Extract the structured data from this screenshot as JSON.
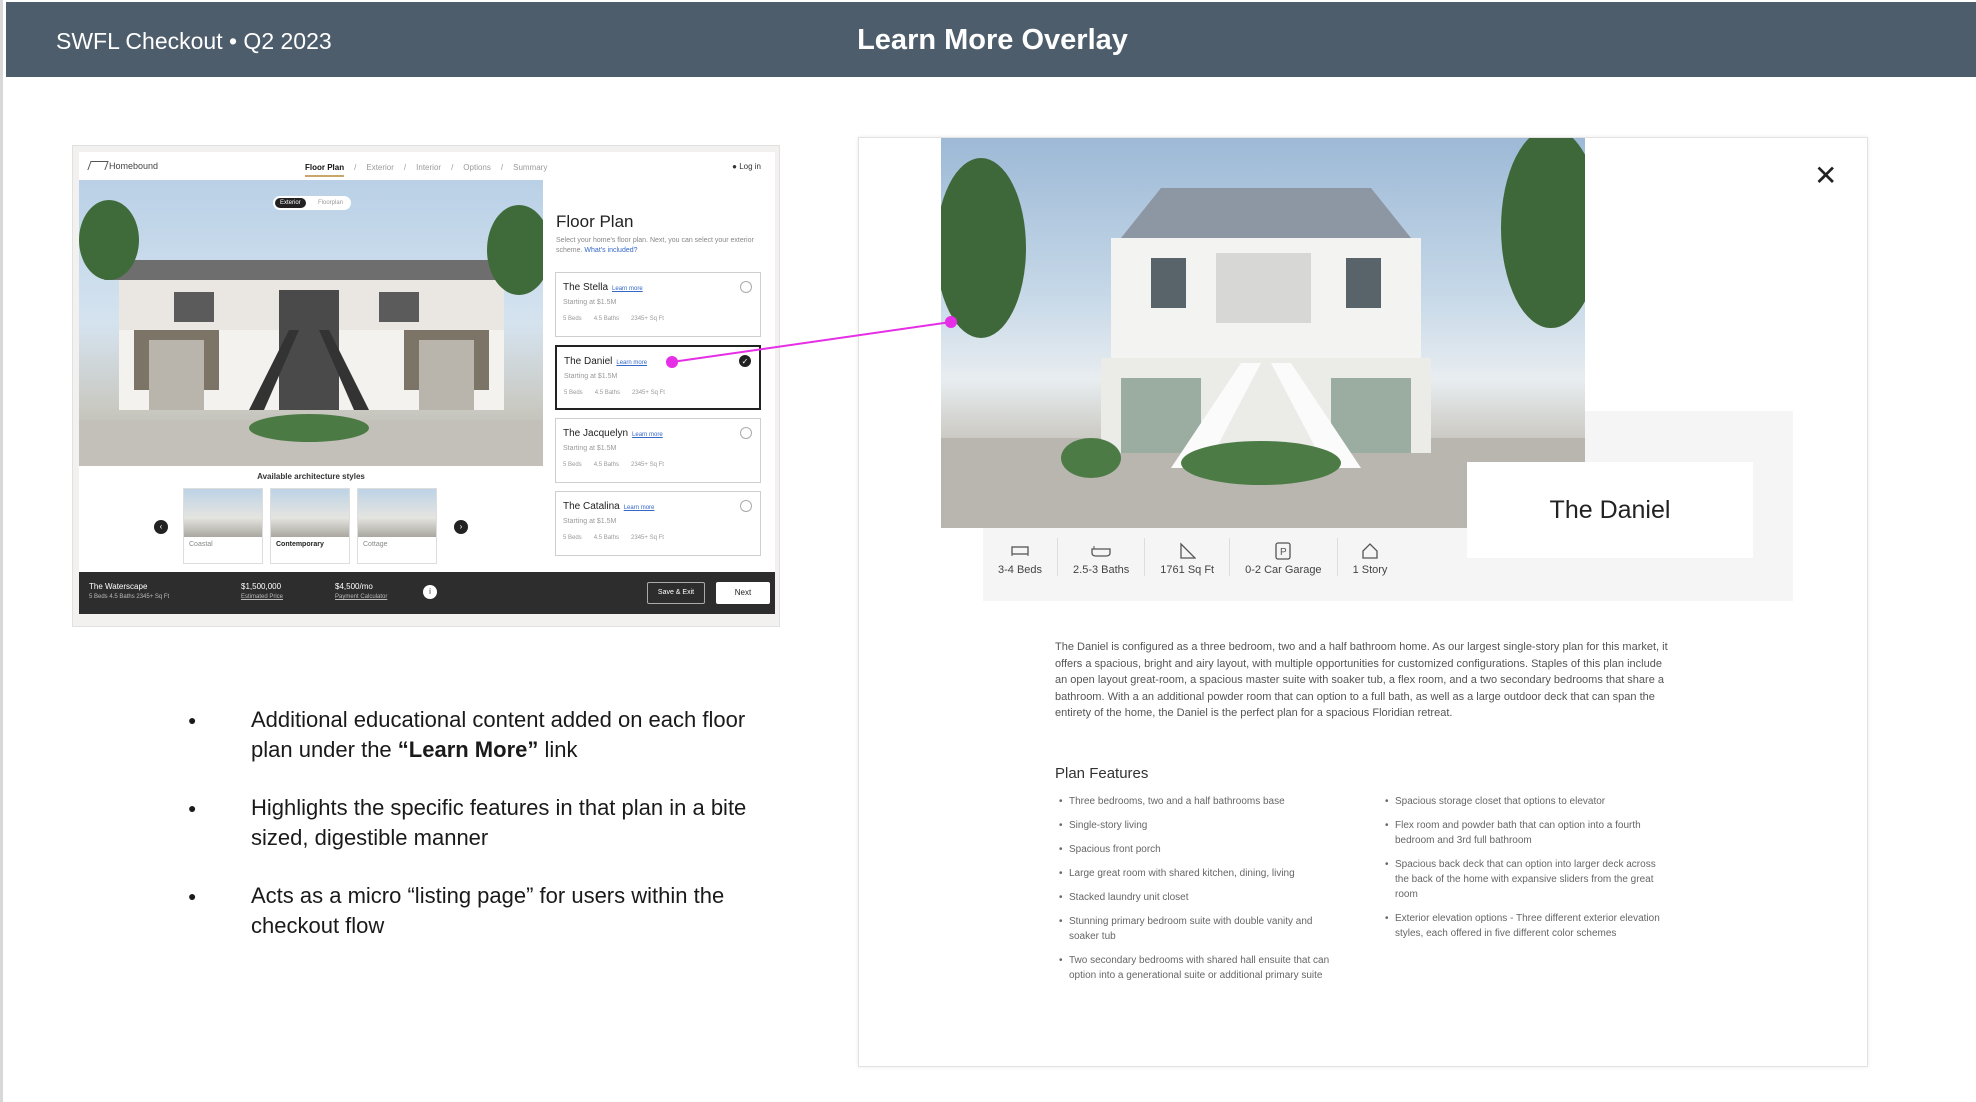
{
  "header": {
    "left": "SWFL Checkout  • Q2 2023",
    "title": "Learn More Overlay"
  },
  "mockup": {
    "brand": "Homebound",
    "steps": [
      "Floor Plan",
      "/",
      "Exterior",
      "/",
      "Interior",
      "/",
      "Options",
      "/",
      "Summary"
    ],
    "login": "Log in",
    "toggle_on": "Exterior",
    "toggle_off": "Floorplan",
    "styles_heading": "Available architecture styles",
    "styles": [
      "Coastal",
      "Contemporary",
      "Cottage"
    ],
    "panel_title": "Floor Plan",
    "panel_sub": "Select your home's floor plan. Next, you can select your exterior scheme.",
    "panel_link": "What's included?",
    "learn_more": "Learn more",
    "plans": [
      {
        "name": "The Stella",
        "price": "Starting at $1.5M"
      },
      {
        "name": "The Daniel",
        "price": "Starting at $1.5M"
      },
      {
        "name": "The Jacquelyn",
        "price": "Starting at $1.5M"
      },
      {
        "name": "The Catalina",
        "price": "Starting at $1.5M"
      }
    ],
    "plan_specs": [
      "5 Beds",
      "4.5 Baths",
      "2345+ Sq Ft"
    ],
    "footer": {
      "home": "The Waterscape",
      "home_specs": "5 Beds    4.5 Baths    2345+ Sq Ft",
      "price": "$1,500,000",
      "price_label": "Estimated Price",
      "monthly": "$4,500/mo",
      "monthly_label": "Payment Calculator",
      "save": "Save & Exit",
      "next": "Next"
    }
  },
  "bullets": [
    {
      "pre": "Additional educational content added on each floor plan under the ",
      "bold": "“Learn More”",
      "post": " link"
    },
    {
      "pre": "Highlights the specific features in that plan in a bite sized, digestible manner",
      "bold": "",
      "post": ""
    },
    {
      "pre": "Acts as a micro “listing page” for users within the checkout flow",
      "bold": "",
      "post": ""
    }
  ],
  "overlay": {
    "close_icon": "✕",
    "name": "The Daniel",
    "stats": [
      {
        "icon": "bed-icon",
        "label": "3-4 Beds"
      },
      {
        "icon": "bath-icon",
        "label": "2.5-3 Baths"
      },
      {
        "icon": "area-icon",
        "label": "1761 Sq Ft"
      },
      {
        "icon": "parking-icon",
        "label": "0-2 Car Garage"
      },
      {
        "icon": "home-icon",
        "label": "1 Story"
      }
    ],
    "description": "The Daniel is configured as a three bedroom, two and a half bathroom home. As our largest single-story plan for this market, it offers a spacious, bright and airy layout, with multiple opportunities for customized configurations. Staples of this plan include an open layout great-room, a spacious master suite with soaker tub, a flex room, and a two secondary bedrooms that share a bathroom. With a an additional powder room that can option to a full bath, as well as a large outdoor deck that can span the entirety of the home, the Daniel is the perfect plan for a spacious Floridian retreat.",
    "features_heading": "Plan Features",
    "features_left": [
      "Three bedrooms, two and a half bathrooms base",
      "Single-story living",
      "Spacious front porch",
      "Large great room with shared kitchen, dining, living",
      "Stacked laundry unit closet",
      "Stunning primary bedroom suite with double vanity and soaker tub",
      "Two secondary bedrooms with shared hall ensuite that can option into a generational suite or additional primary suite"
    ],
    "features_right": [
      "Spacious storage closet that options to elevator",
      "Flex room and powder bath that can option into a fourth bedroom and 3rd full bathroom",
      "Spacious back deck that can option into larger deck across the back of the home with expansive sliders from the great room",
      "Exterior elevation options - Three different exterior elevation styles, each offered in five different color schemes"
    ]
  },
  "colors": {
    "header_bg": "#4e5d6b",
    "connector": "#e52ee6",
    "link": "#3567c9"
  }
}
